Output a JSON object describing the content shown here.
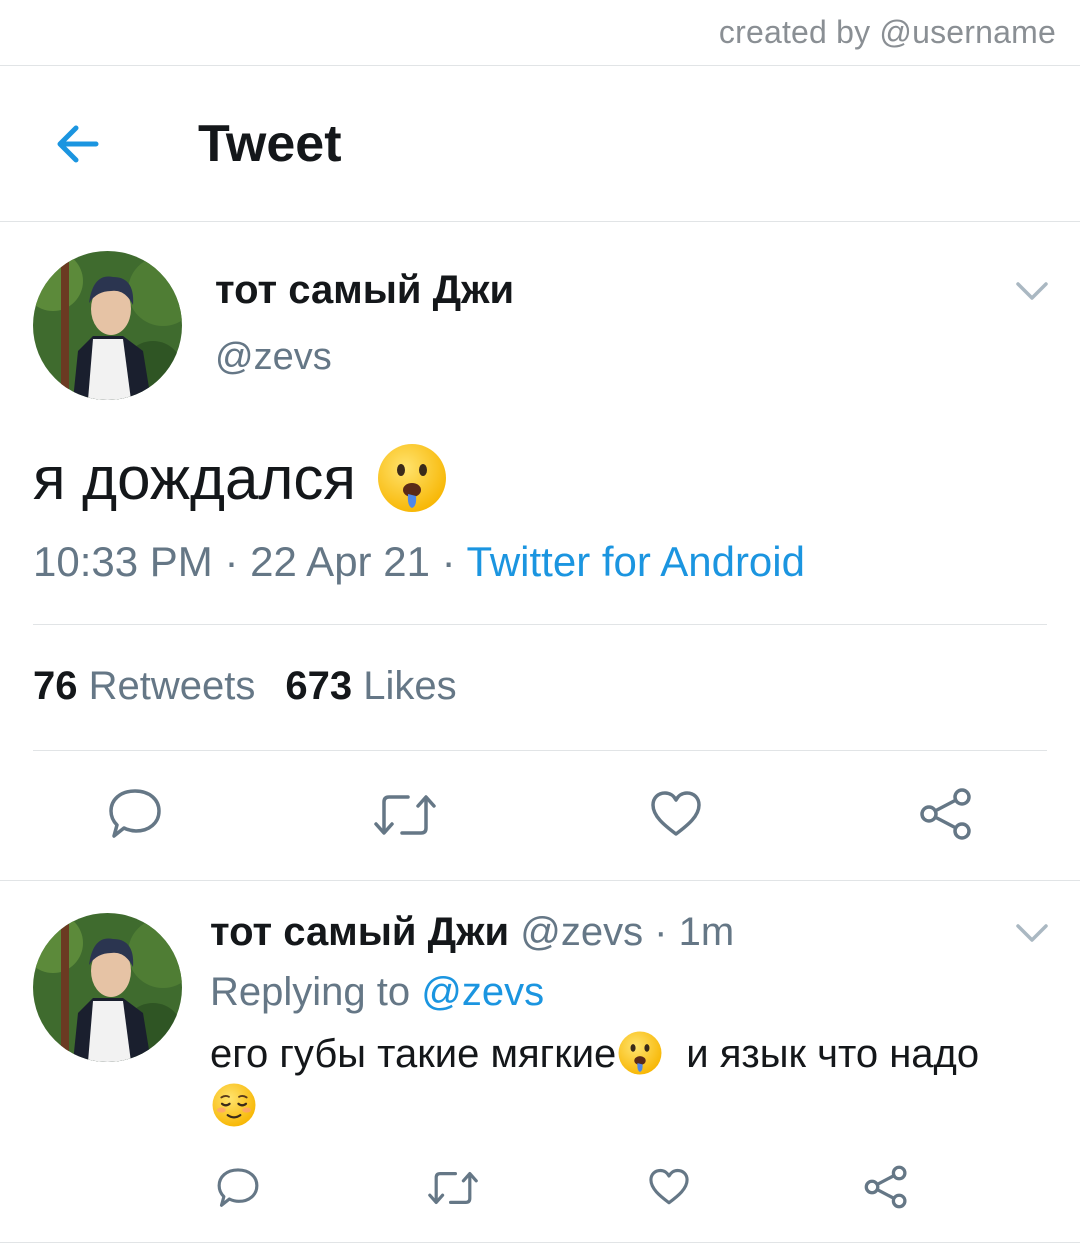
{
  "watermark": "created by @username",
  "header": {
    "title": "Tweet",
    "back_icon": "arrow-left-icon"
  },
  "colors": {
    "accent": "#1b95e0",
    "text": "#14171a",
    "muted": "#657786",
    "divider": "#e1e4e6"
  },
  "tweet": {
    "display_name": "тот самый Джи",
    "handle": "@zevs",
    "text": "я дождался",
    "emoji": "drooling-face",
    "time": "10:33 PM",
    "date": "22 Apr 21",
    "source": "Twitter for Android",
    "retweets_count": "76",
    "retweets_label": "Retweets",
    "likes_count": "673",
    "likes_label": "Likes"
  },
  "reply": {
    "display_name": "тот самый Джи",
    "handle_time": "@zevs · 1m",
    "replying_label": "Replying to",
    "replying_mention": "@zevs",
    "text_part1": "его губы такие мягкие",
    "text_part2": "и язык что надо",
    "emojis": [
      "drooling-face",
      "relieved-face"
    ]
  },
  "actions": [
    "reply-icon",
    "retweet-icon",
    "like-icon",
    "share-icon"
  ]
}
